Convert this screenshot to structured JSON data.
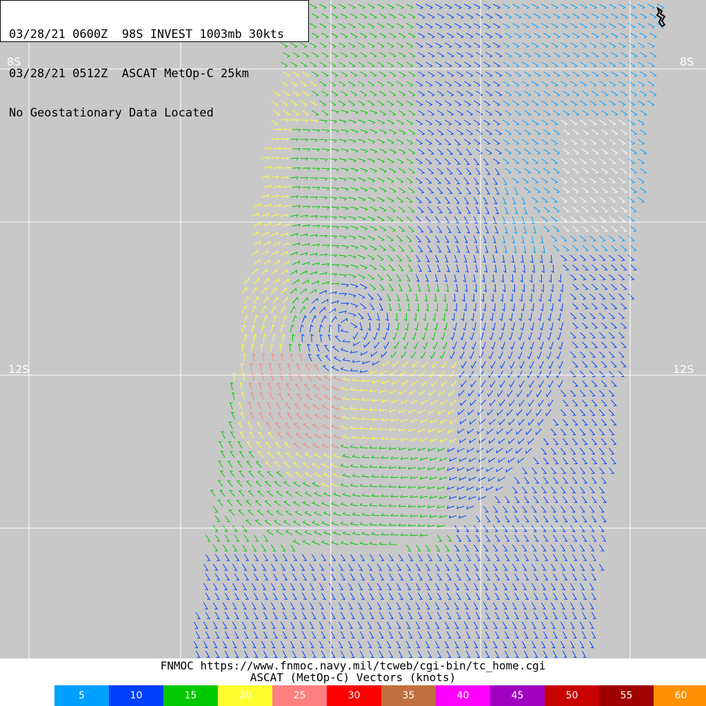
{
  "header": {
    "line1": "03/28/21 0600Z  98S INVEST 1003mb 30kts",
    "line2": "03/28/21 0512Z  ASCAT MetOp-C 25km",
    "line3": "No Geostationary Data Located"
  },
  "grid": {
    "lat_labels": [
      {
        "text": "8S"
      },
      {
        "text": "12S"
      }
    ]
  },
  "footer": {
    "source_line": "FNMOC https://www.fnmoc.navy.mil/tcweb/cgi-bin/tc_home.cgi",
    "product_line": "ASCAT (MetOp-C) Vectors (knots)"
  },
  "legend": [
    {
      "label": "5",
      "color": "#00a0ff"
    },
    {
      "label": "10",
      "color": "#0040ff"
    },
    {
      "label": "15",
      "color": "#00c800"
    },
    {
      "label": "20",
      "color": "#ffff30"
    },
    {
      "label": "25",
      "color": "#ff8080"
    },
    {
      "label": "30",
      "color": "#ff0000"
    },
    {
      "label": "35",
      "color": "#c07040"
    },
    {
      "label": "40",
      "color": "#ff00ff"
    },
    {
      "label": "45",
      "color": "#a000c0"
    },
    {
      "label": "50",
      "color": "#c80000"
    },
    {
      "label": "55",
      "color": "#a00000"
    },
    {
      "label": "60",
      "color": "#ff9000"
    }
  ],
  "map": {
    "background_color": "#c8c8c8",
    "grid_color": "#ffffff",
    "low_center_label": ""
  }
}
